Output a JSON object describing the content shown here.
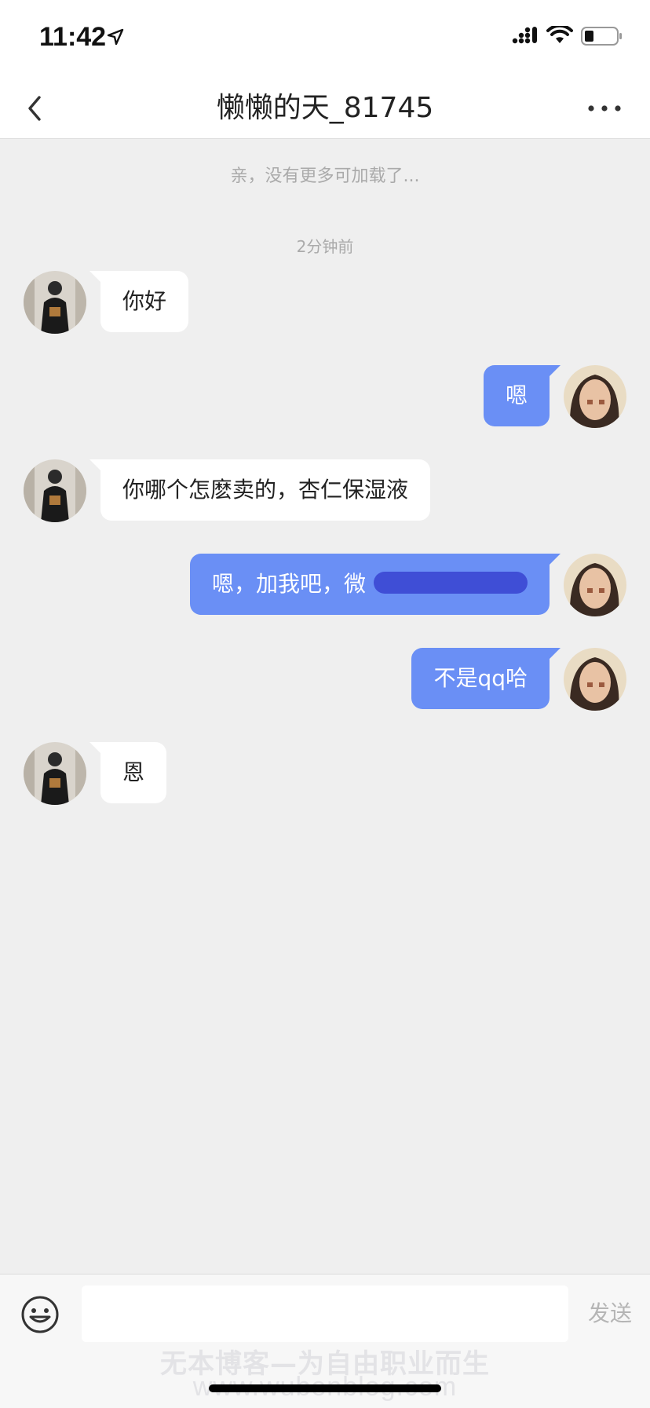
{
  "status_bar": {
    "time": "11:42"
  },
  "header": {
    "title": "懒懒的天_81745"
  },
  "notice": "亲，没有更多可加载了...",
  "timestamp": "2分钟前",
  "messages": [
    {
      "side": "left",
      "text": "你好"
    },
    {
      "side": "right",
      "text": "嗯"
    },
    {
      "side": "left",
      "text": "你哪个怎麽卖的，杏仁保湿液"
    },
    {
      "side": "right",
      "text": "嗯，加我吧，微"
    },
    {
      "side": "right",
      "text": "不是qq哈"
    },
    {
      "side": "left",
      "text": "恩"
    }
  ],
  "input": {
    "placeholder": "",
    "send_label": "发送"
  },
  "watermark": {
    "line1": "无本博客—为自由职业而生",
    "line2": "www.wubenblog.com"
  },
  "colors": {
    "outgoing_bubble": "#6a8ff5",
    "incoming_bubble": "#ffffff",
    "background": "#efefef"
  }
}
